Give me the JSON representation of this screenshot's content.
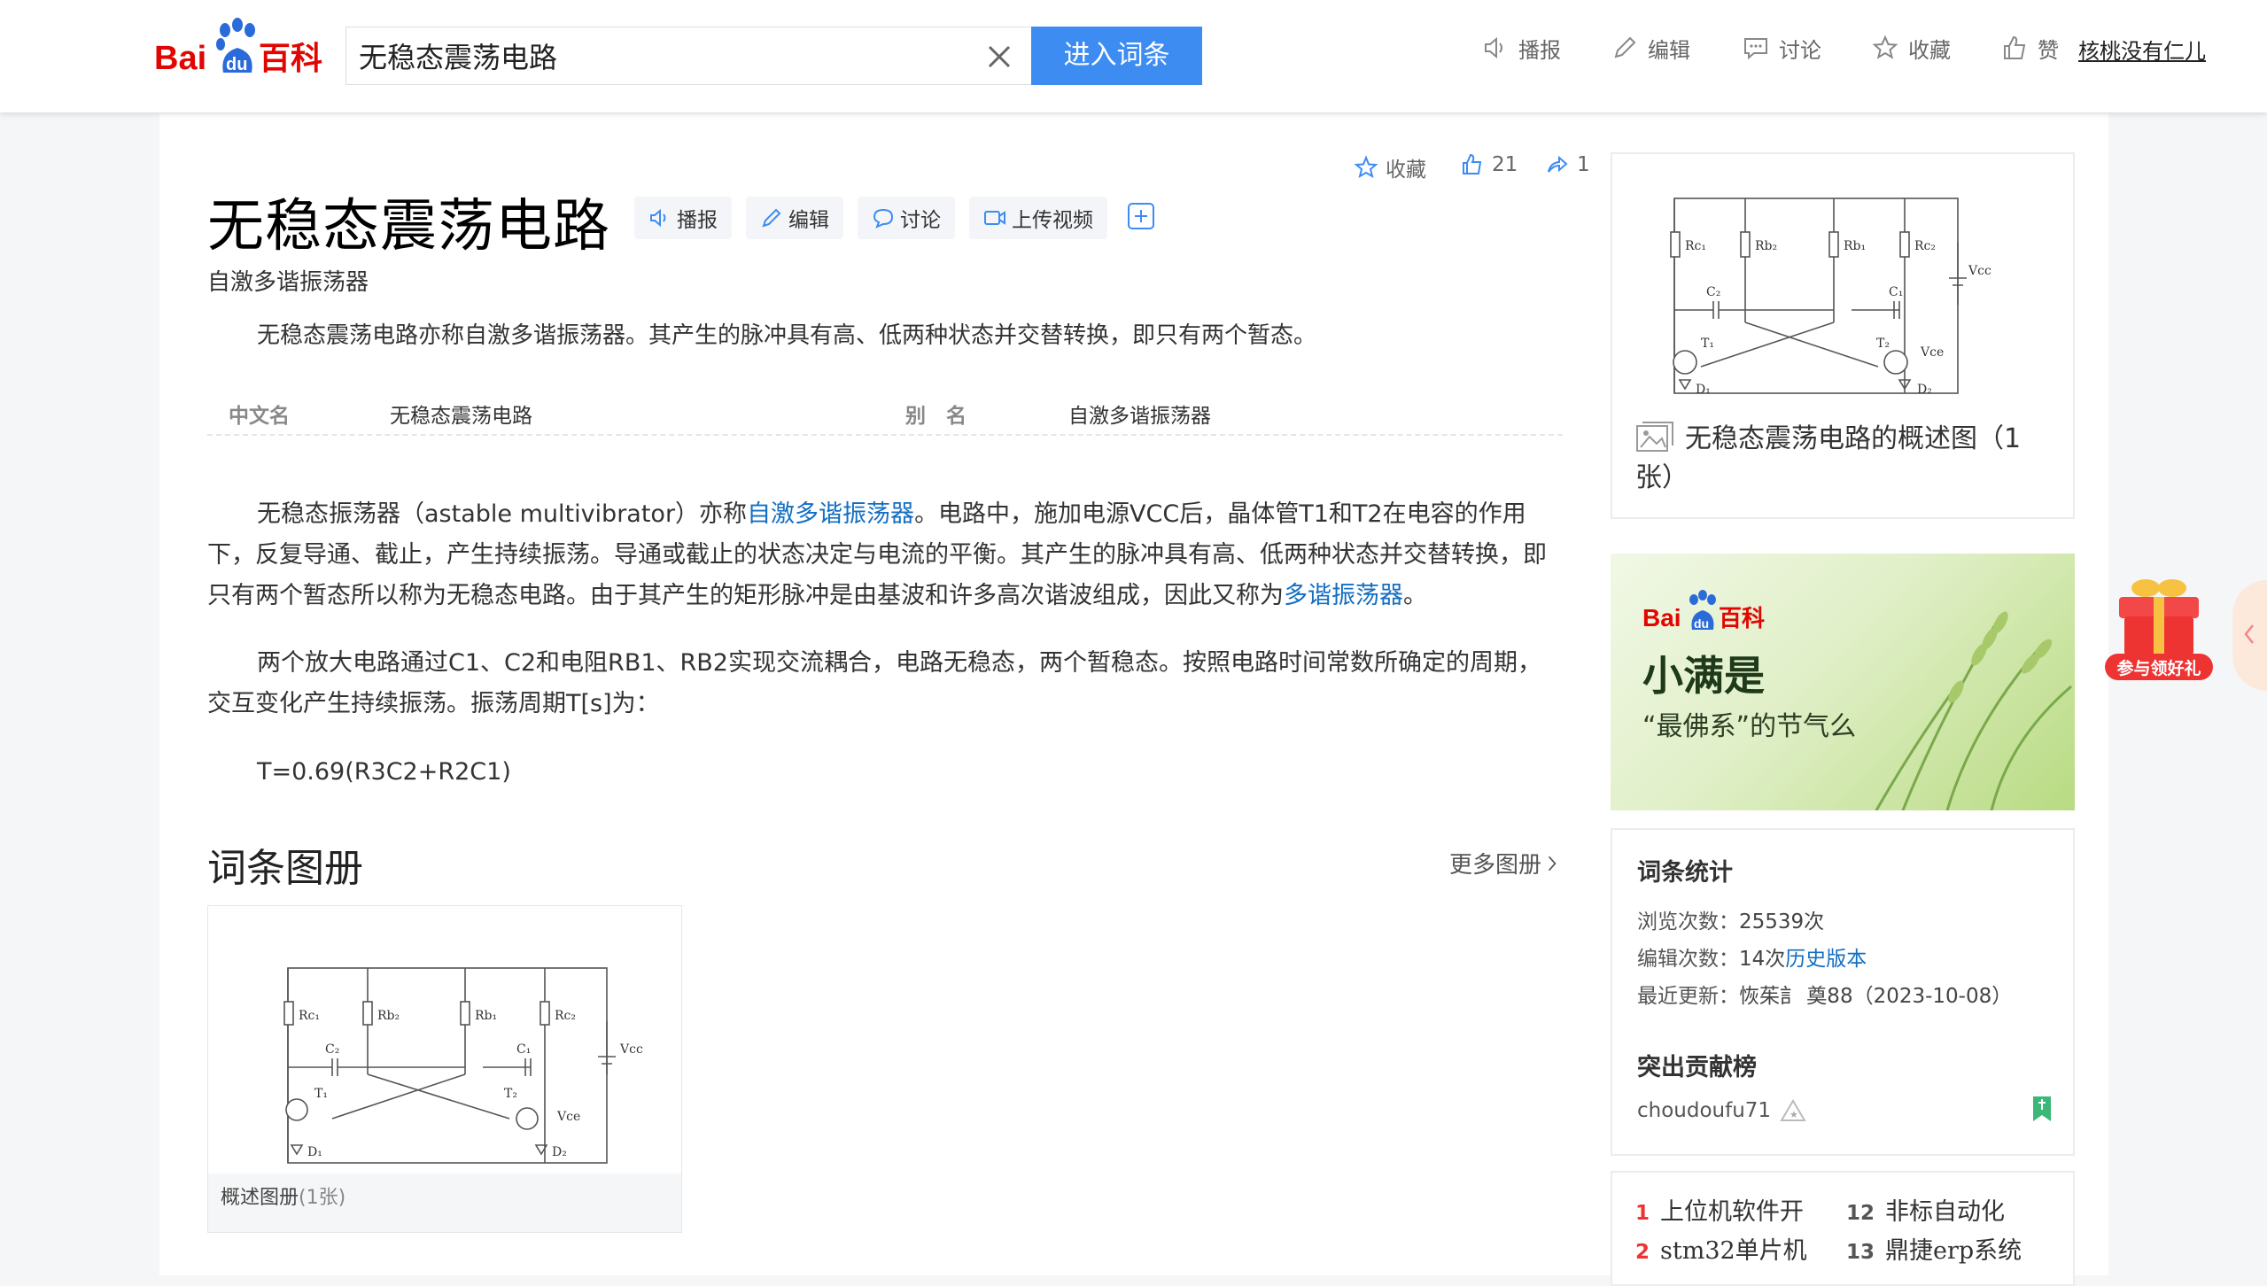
{
  "header": {
    "logo_text": "Baidu百科",
    "search_value": "无稳态震荡电路",
    "enter_label": "进入词条",
    "actions": [
      {
        "label": "播报",
        "icon": "speaker-icon"
      },
      {
        "label": "编辑",
        "icon": "pencil-icon"
      },
      {
        "label": "讨论",
        "icon": "chat-icon"
      },
      {
        "label": "收藏",
        "icon": "star-icon"
      },
      {
        "label": "赞",
        "icon": "thumbs-up-icon"
      }
    ],
    "username": "核桃没有仁儿"
  },
  "entry": {
    "title": "无稳态震荡电路",
    "title_buttons": [
      "播报",
      "编辑",
      "讨论",
      "上传视频"
    ],
    "favorite_label": "收藏",
    "likes": "21",
    "shares": "1",
    "subtitle": "自激多谐振荡器",
    "summary": "无稳态震荡电路亦称自激多谐振荡器。其产生的脉冲具有高、低两种状态并交替转换，即只有两个暂态。",
    "basic_info": [
      {
        "label": "中文名",
        "value": "无稳态震荡电路"
      },
      {
        "label": "别　名",
        "value": "自激多谐振荡器"
      }
    ],
    "para1": {
      "part1": "无稳态振荡器（astable multivibrator）亦称",
      "link1": "自激多谐振荡器",
      "part2": "。电路中，施加电源VCC后，晶体管T1和T2在电容的作用下，反复导通、截止，产生持续振荡。导通或截止的状态决定与电流的平衡。其产生的脉冲具有高、低两种状态并交替转换，即只有两个暂态所以称为无稳态电路。由于其产生的矩形脉冲是由基波和许多高次谐波组成，因此又称为",
      "link2": "多谐振荡器",
      "part3": "。"
    },
    "para2": "两个放大电路通过C1、C2和电阻RB1、RB2实现交流耦合，电路无稳态，两个暂稳态。按照电路时间常数所确定的周期，交互变化产生持续振荡。振荡周期T[s]为：",
    "formula": "T=0.69(R3C2+R2C1)",
    "album_title": "词条图册",
    "more_album": "更多图册",
    "album_caption": "概述图册",
    "album_count": "(1张)"
  },
  "sidebar": {
    "summary_pic_caption": "无稳态震荡电路的概述图（1张）",
    "ad": {
      "brand": "Baidu百科",
      "title": "小满是",
      "subtitle": "“最佛系”的节气么"
    },
    "stats": {
      "heading": "词条统计",
      "views_label": "浏览次数：",
      "views": "25539次",
      "edits_label": "编辑次数：",
      "edits": "14次",
      "history_link": "历史版本",
      "updated_label": "最近更新：",
      "updated_by": "恢茱訁 奠88",
      "updated_date": "（2023-10-08）",
      "contrib_heading": "突出贡献榜",
      "contributor": "choudoufu71"
    },
    "hot": [
      {
        "num": "1",
        "label": "上位机软件开"
      },
      {
        "num": "12",
        "label": "非标自动化"
      },
      {
        "num": "2",
        "label": "stm32单片机"
      },
      {
        "num": "13",
        "label": "鼎捷erp系统"
      }
    ],
    "gift_label": "参与领好礼"
  },
  "colors": {
    "accent_blue": "#3d8cf2",
    "link_blue": "#136ec2",
    "hot_red": "#e33333"
  }
}
